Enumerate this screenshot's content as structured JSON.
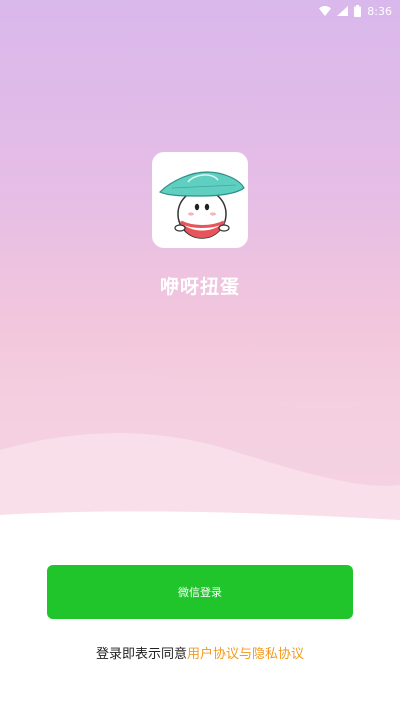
{
  "status_bar": {
    "time": "8:36",
    "icons": [
      "wifi-icon",
      "signal-icon",
      "battery-icon"
    ]
  },
  "app": {
    "name": "咿呀扭蛋",
    "logo_icon": "capsule-mascot-icon"
  },
  "login": {
    "button_label": "微信登录",
    "button_color": "#1fc52b"
  },
  "agreement": {
    "prefix": "登录即表示同意",
    "link_text": "用户协议与隐私协议",
    "link_color": "#f29a1f"
  },
  "colors": {
    "gradient_top": "#d9b8ec",
    "gradient_bottom": "#f8dde6"
  }
}
